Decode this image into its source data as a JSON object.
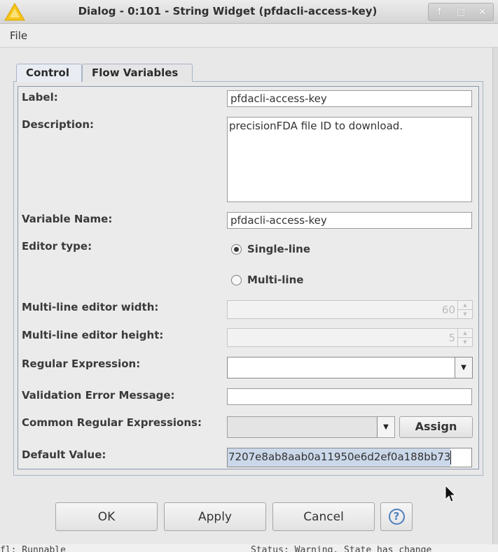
{
  "window": {
    "title": "Dialog - 0:101 - String Widget (pfdacli-access-key)",
    "controls": {
      "pin": "↑",
      "maximize": "□",
      "close": "✕"
    }
  },
  "menu": {
    "file": "File"
  },
  "tabs": {
    "control": "Control",
    "flow_variables": "Flow Variables"
  },
  "form": {
    "label": {
      "caption": "Label:",
      "value": "pfdacli-access-key"
    },
    "description": {
      "caption": "Description:",
      "value": "precisionFDA file ID to download."
    },
    "variable_name": {
      "caption": "Variable Name:",
      "value": "pfdacli-access-key"
    },
    "editor_type": {
      "caption": "Editor type:",
      "single_line": "Single-line",
      "multi_line": "Multi-line",
      "selected": "Single-line"
    },
    "multiline_width": {
      "caption": "Multi-line editor width:",
      "value": "60"
    },
    "multiline_height": {
      "caption": "Multi-line editor height:",
      "value": "5"
    },
    "regex": {
      "caption": "Regular Expression:",
      "value": ""
    },
    "validation_error": {
      "caption": "Validation Error Message:",
      "value": ""
    },
    "common_regex": {
      "caption": "Common Regular Expressions:",
      "assign_label": "Assign"
    },
    "default_value": {
      "caption": "Default Value:",
      "value": "7207e8ab8aab0a11950e6d2ef0a188bb73"
    }
  },
  "buttons": {
    "ok": "OK",
    "apply": "Apply",
    "cancel": "Cancel",
    "help": "?"
  },
  "status_strip": {
    "left": "fl: Runnable",
    "right": "Status: Warning. State has change"
  },
  "colors": {
    "accent": "#4f7fbe",
    "warning_icon": "#f5c518",
    "selection": "#cbd8ea"
  },
  "icons": {
    "title": "warning-icon",
    "help": "help-icon"
  }
}
